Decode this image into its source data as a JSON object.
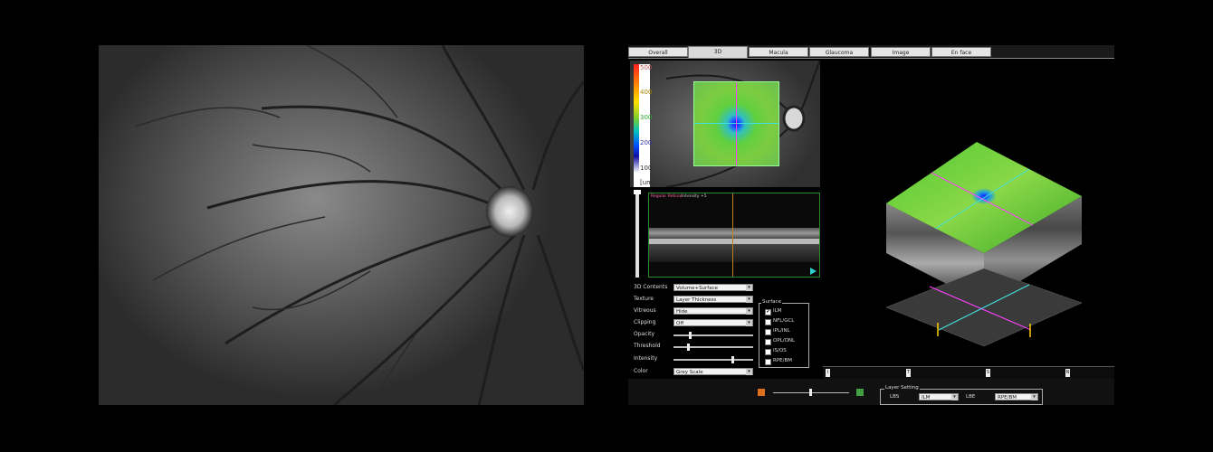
{
  "tabs": [
    "Overall",
    "3D",
    "Macula",
    "Glaucoma",
    "Image",
    "En face"
  ],
  "active_tab": "3D",
  "colorbar": {
    "ticks": [
      "500",
      "400",
      "300",
      "200",
      "100",
      "[um]"
    ]
  },
  "bscan": {
    "title": "Regular Retinal",
    "subtitle": "Intensity +5"
  },
  "controls": [
    {
      "label": "3D Contents",
      "value": "Volume+Surface"
    },
    {
      "label": "Texture",
      "value": "Layer Thickness"
    },
    {
      "label": "Vitreous",
      "value": "Hide"
    },
    {
      "label": "Clipping",
      "value": "Off"
    }
  ],
  "sliders": [
    {
      "label": "Opacity",
      "level": 0.2
    },
    {
      "label": "Threshold",
      "level": 0.18
    },
    {
      "label": "Intensity",
      "level": 0.75
    }
  ],
  "color": {
    "label": "Color",
    "value": "Grey Scale"
  },
  "surface": {
    "title": "Surface",
    "items": [
      {
        "label": "ILM",
        "checked": true
      },
      {
        "label": "NFL/GCL",
        "checked": false
      },
      {
        "label": "IPL/INL",
        "checked": false
      },
      {
        "label": "OPL/ONL",
        "checked": false
      },
      {
        "label": "IS/OS",
        "checked": false
      },
      {
        "label": "RPE/BM",
        "checked": false
      }
    ]
  },
  "rulers": [
    "I",
    "T",
    "S",
    "N"
  ],
  "layer_setting": {
    "title": "Layer Setting",
    "lbs_label": "LBS",
    "lbs_value": "ILM",
    "lbe_label": "LBE",
    "lbe_value": "RPE/BM"
  },
  "colors": {
    "accent_green": "#5ccf3a",
    "magenta_line": "#ff40ff",
    "cyan_line": "#40e0e0"
  }
}
